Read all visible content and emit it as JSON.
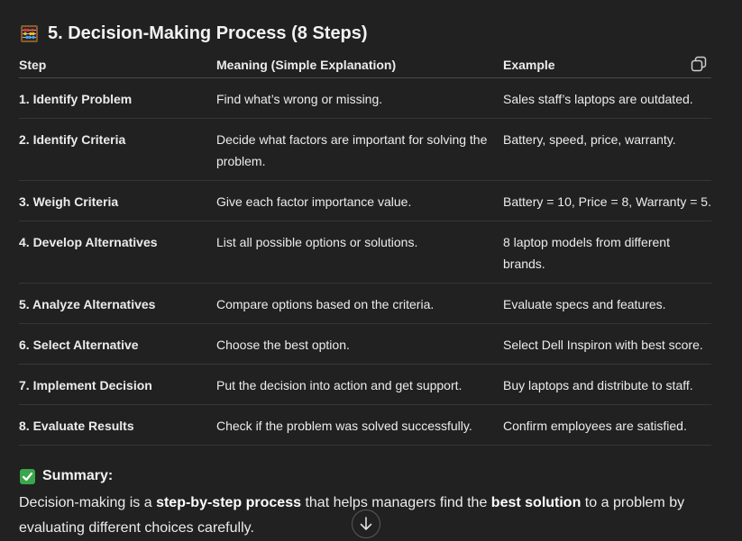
{
  "section": {
    "icon": "abacus-icon",
    "title": "5. Decision-Making Process (8 Steps)"
  },
  "table": {
    "headers": [
      "Step",
      "Meaning (Simple Explanation)",
      "Example"
    ],
    "copy_icon": "copy-icon",
    "rows": [
      {
        "step": "1. Identify Problem",
        "meaning": "Find what’s wrong or missing.",
        "example": "Sales staff’s laptops are outdated."
      },
      {
        "step": "2. Identify Criteria",
        "meaning": "Decide what factors are important for solving the problem.",
        "example": "Battery, speed, price, warranty."
      },
      {
        "step": "3. Weigh Criteria",
        "meaning": "Give each factor importance value.",
        "example": "Battery = 10, Price = 8, Warranty = 5."
      },
      {
        "step": "4. Develop Alternatives",
        "meaning": "List all possible options or solutions.",
        "example": "8 laptop models from different brands."
      },
      {
        "step": "5. Analyze Alternatives",
        "meaning": "Compare options based on the criteria.",
        "example": "Evaluate specs and features."
      },
      {
        "step": "6. Select Alternative",
        "meaning": "Choose the best option.",
        "example": "Select Dell Inspiron with best score."
      },
      {
        "step": "7. Implement Decision",
        "meaning": "Put the decision into action and get support.",
        "example": "Buy laptops and distribute to staff."
      },
      {
        "step": "8. Evaluate Results",
        "meaning": "Check if the problem was solved successfully.",
        "example": "Confirm employees are satisfied."
      }
    ]
  },
  "summary": {
    "icon": "check-mark-icon",
    "title": "Summary:",
    "text_1": "Decision-making is a ",
    "bold_1": "step-by-step process",
    "text_2": " that helps managers find the ",
    "bold_2": "best solution",
    "text_3": " to a problem by evaluating different choices carefully."
  },
  "scroll": {
    "icon": "arrow-down-icon"
  }
}
